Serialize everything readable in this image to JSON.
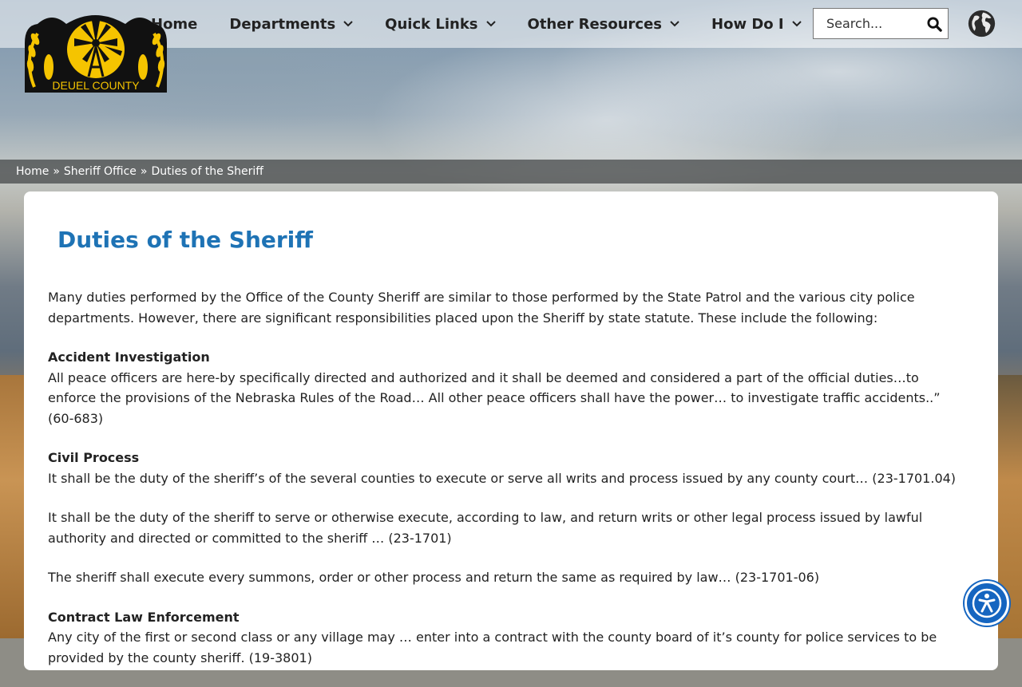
{
  "logo": {
    "text": "DEUEL COUNTY",
    "icon": "windmill-wheat-logo"
  },
  "nav": {
    "items": [
      {
        "label": "Home",
        "has_dropdown": false
      },
      {
        "label": "Departments",
        "has_dropdown": true
      },
      {
        "label": "Quick Links",
        "has_dropdown": true
      },
      {
        "label": "Other Resources",
        "has_dropdown": true
      },
      {
        "label": "How Do I",
        "has_dropdown": true
      }
    ]
  },
  "search": {
    "placeholder": "Search...",
    "icon": "search-icon"
  },
  "translate": {
    "icon": "globe-icon"
  },
  "breadcrumb": {
    "items": [
      "Home",
      "Sheriff Office",
      "Duties of the Sheriff"
    ],
    "separator": "»"
  },
  "page": {
    "title": "Duties of the Sheriff",
    "intro": "Many duties performed by the Office of the County Sheriff are similar to those performed by the State Patrol and the various city police departments. However, there are significant responsibilities placed upon the Sheriff by state statute. These include the following:",
    "sections": [
      {
        "heading": "Accident Investigation",
        "paragraphs": [
          "All peace officers are here-by specifically directed and authorized and it shall be deemed and considered a part of the official duties…to enforce the provisions of the Nebraska Rules of the Road… All other peace officers shall have the power… to investigate traffic accidents..”   (60-683)"
        ]
      },
      {
        "heading": "Civil Process",
        "paragraphs": [
          "It shall be the duty of the sheriff’s of the several counties to execute or serve all writs and process issued by any county court… (23-1701.04)",
          "It shall be the duty of the sheriff to serve or otherwise execute, according to law, and return writs or other legal process issued by lawful authority and directed or committed to the sheriff … (23-1701)",
          "The sheriff shall execute every summons, order or other process and return the same as required by law… (23-1701-06)"
        ]
      },
      {
        "heading": "Contract Law Enforcement",
        "paragraphs": [
          "Any city of the first or second class or any village may … enter into a contract with the county board of it’s county for police services to be provided by the county sheriff. (19-3801)"
        ]
      }
    ]
  },
  "accessibility": {
    "icon": "accessibility-icon"
  },
  "colors": {
    "title": "#1e73b5",
    "accent": "#1565c0",
    "logo_yellow": "#f5c400"
  }
}
